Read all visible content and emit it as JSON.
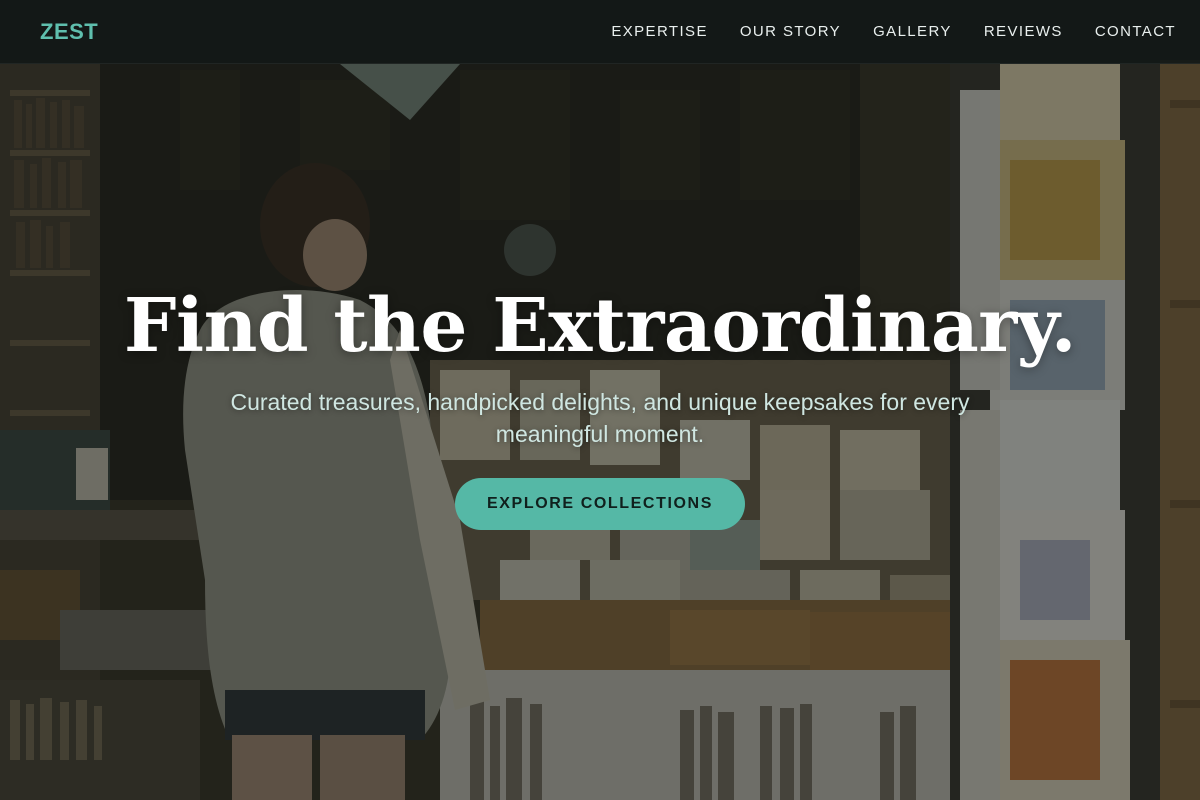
{
  "brand": {
    "name": "ZEST",
    "accent_color": "#55b8a6"
  },
  "nav": {
    "items": [
      {
        "label": "EXPERTISE"
      },
      {
        "label": "OUR STORY"
      },
      {
        "label": "GALLERY"
      },
      {
        "label": "REVIEWS"
      },
      {
        "label": "CONTACT"
      }
    ]
  },
  "hero": {
    "title": "Find the Extraordinary.",
    "subtitle": "Curated treasures, handpicked delights, and unique keepsakes for every meaningful moment.",
    "cta_label": "EXPLORE COLLECTIONS"
  }
}
